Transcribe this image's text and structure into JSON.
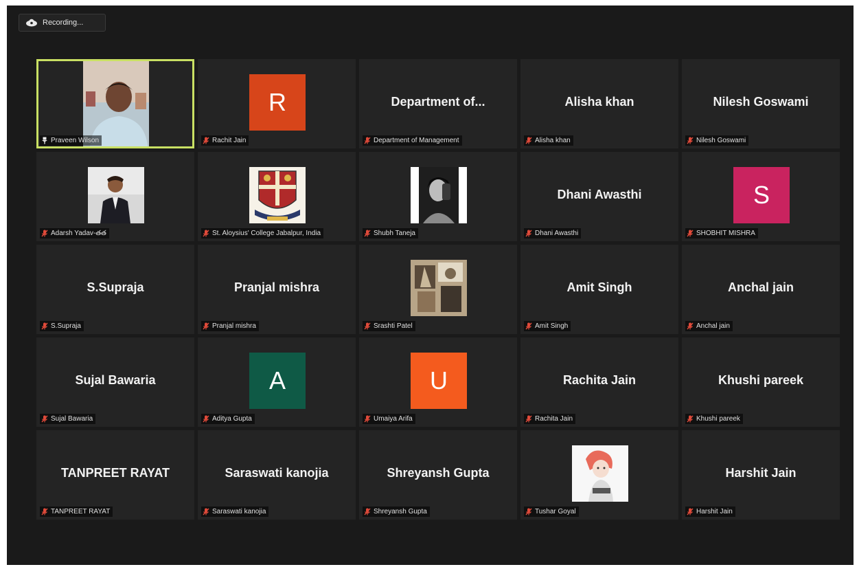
{
  "recording": {
    "label": "Recording..."
  },
  "colors": {
    "active_border": "#c9e063",
    "mic_muted": "#e04a3a"
  },
  "tiles": [
    {
      "type": "video",
      "label": "Praveen Wilson",
      "active": true
    },
    {
      "type": "avatar",
      "letter": "R",
      "color": "#d7451a",
      "label": "Rachit Jain"
    },
    {
      "type": "name",
      "name": "Department  of...",
      "label": "Department of Management"
    },
    {
      "type": "name",
      "name": "Alisha khan",
      "label": "Alisha khan"
    },
    {
      "type": "name",
      "name": "Nilesh Goswami",
      "label": "Nilesh Goswami"
    },
    {
      "type": "photo",
      "photo": "person-suit",
      "label": "Adarsh Yadav-తత"
    },
    {
      "type": "photo",
      "photo": "college-crest",
      "label": "St. Aloysius' College Jabalpur, India"
    },
    {
      "type": "photo",
      "photo": "bw-portrait",
      "label": "Shubh Taneja"
    },
    {
      "type": "name",
      "name": "Dhani Awasthi",
      "label": "Dhani Awasthi"
    },
    {
      "type": "avatar",
      "letter": "S",
      "color": "#c9235f",
      "label": "SHOBHIT MISHRA"
    },
    {
      "type": "name",
      "name": "S.Supraja",
      "label": "S.Supraja"
    },
    {
      "type": "name",
      "name": "Pranjal mishra",
      "label": "Pranjal mishra"
    },
    {
      "type": "photo",
      "photo": "abstract-art",
      "label": "Srashti Patel"
    },
    {
      "type": "name",
      "name": "Amit Singh",
      "label": "Amit Singh"
    },
    {
      "type": "name",
      "name": "Anchal jain",
      "label": "Anchal jain"
    },
    {
      "type": "name",
      "name": "Sujal Bawaria",
      "label": "Sujal Bawaria"
    },
    {
      "type": "avatar",
      "letter": "A",
      "color": "#0f5a46",
      "label": "Aditya Gupta"
    },
    {
      "type": "avatar",
      "letter": "U",
      "color": "#f45b1e",
      "label": "Umaiya Arifa"
    },
    {
      "type": "name",
      "name": "Rachita Jain",
      "label": "Rachita Jain"
    },
    {
      "type": "name",
      "name": "Khushi pareek",
      "label": "Khushi pareek"
    },
    {
      "type": "name",
      "name": "TANPREET RAYAT",
      "label": "TANPREET RAYAT"
    },
    {
      "type": "name",
      "name": "Saraswati kanojia",
      "label": "Saraswati kanojia"
    },
    {
      "type": "name",
      "name": "Shreyansh Gupta",
      "label": "Shreyansh Gupta"
    },
    {
      "type": "photo",
      "photo": "doll-illustration",
      "label": "Tushar Goyal"
    },
    {
      "type": "name",
      "name": "Harshit Jain",
      "label": "Harshit Jain"
    }
  ]
}
